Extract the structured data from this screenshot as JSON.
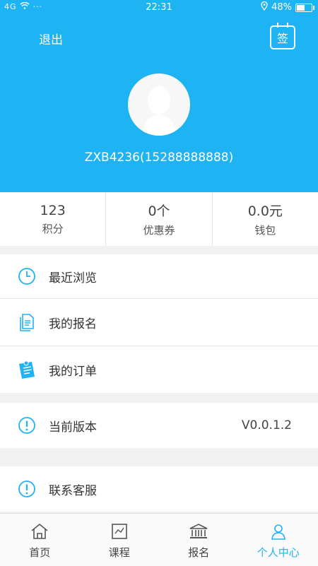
{
  "status_bar": {
    "signal": "4G",
    "dots": "···",
    "time": "22:31",
    "battery_percent": "48%",
    "battery_level": 0.48
  },
  "header": {
    "logout_label": "退出",
    "sign_label": "签",
    "username": "ZXB4236(15288888888)"
  },
  "stats": [
    {
      "value": "123",
      "label": "积分"
    },
    {
      "value": "0个",
      "label": "优惠券"
    },
    {
      "value": "0.0元",
      "label": "钱包"
    }
  ],
  "menu": {
    "recent": "最近浏览",
    "my_signup": "我的报名",
    "my_orders": "我的订单",
    "version_label": "当前版本",
    "version_value": "V0.0.1.2",
    "contact": "联系客服"
  },
  "tabs": [
    {
      "label": "首页",
      "icon": "home-icon"
    },
    {
      "label": "课程",
      "icon": "course-icon"
    },
    {
      "label": "报名",
      "icon": "building-icon"
    },
    {
      "label": "个人中心",
      "icon": "person-icon"
    }
  ],
  "colors": {
    "accent": "#1eb3f3",
    "background": "#f1f1f1"
  }
}
